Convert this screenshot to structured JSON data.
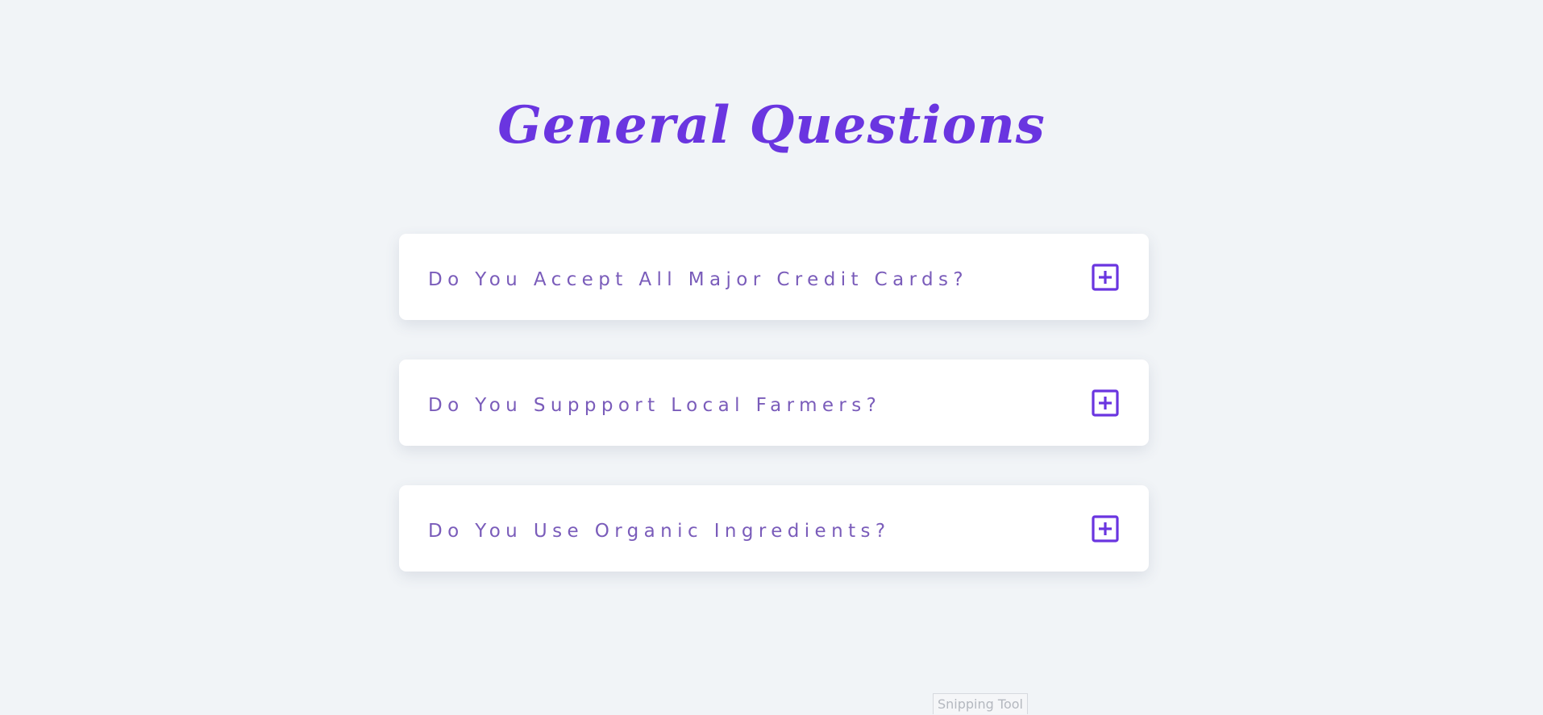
{
  "page": {
    "title": "General Questions"
  },
  "faq": {
    "items": [
      {
        "question": "Do You Accept All Major Credit Cards?",
        "icon": "plus-square-icon"
      },
      {
        "question": "Do You Suppport Local Farmers?",
        "icon": "plus-square-icon"
      },
      {
        "question": "Do You Use Organic Ingredients?",
        "icon": "plus-square-icon"
      }
    ]
  },
  "overlay": {
    "snipping_label": "Snipping Tool"
  },
  "colors": {
    "background": "#f1f4f7",
    "accent": "#6a35e0",
    "question_text": "#7a5cba",
    "card": "#ffffff"
  }
}
